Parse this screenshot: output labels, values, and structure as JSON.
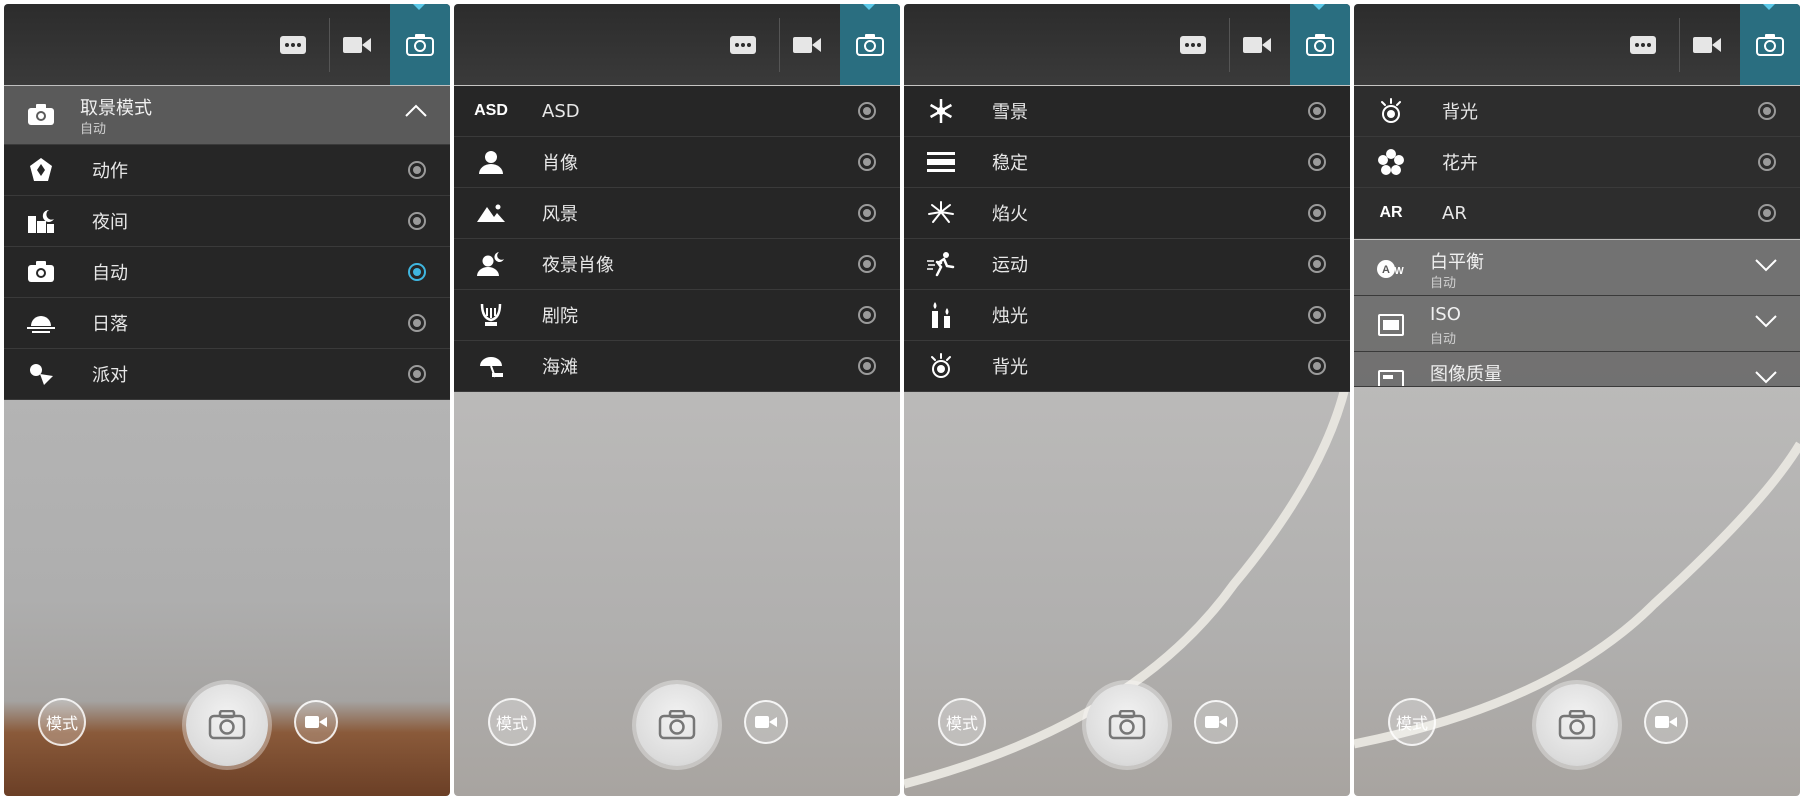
{
  "panels": [
    {
      "header": {
        "title": "取景模式",
        "subtitle": "自动"
      },
      "items": [
        {
          "label": "动作",
          "icon": "action-icon",
          "selected": false
        },
        {
          "label": "夜间",
          "icon": "night-icon",
          "selected": false
        },
        {
          "label": "自动",
          "icon": "camera-icon",
          "selected": true
        },
        {
          "label": "日落",
          "icon": "sunset-icon",
          "selected": false
        },
        {
          "label": "派对",
          "icon": "party-icon",
          "selected": false
        }
      ],
      "mode_label": "模式"
    },
    {
      "items": [
        {
          "label": "ASD",
          "icon_text": "ASD",
          "selected": false
        },
        {
          "label": "肖像",
          "icon": "portrait-icon",
          "selected": false
        },
        {
          "label": "风景",
          "icon": "landscape-icon",
          "selected": false
        },
        {
          "label": "夜景肖像",
          "icon": "night-portrait-icon",
          "selected": false
        },
        {
          "label": "剧院",
          "icon": "theater-icon",
          "selected": false
        },
        {
          "label": "海滩",
          "icon": "beach-icon",
          "selected": false
        }
      ],
      "mode_label": "模式"
    },
    {
      "items": [
        {
          "label": "雪景",
          "icon": "snow-icon",
          "selected": false
        },
        {
          "label": "稳定",
          "icon": "steady-icon",
          "selected": false
        },
        {
          "label": "焰火",
          "icon": "fireworks-icon",
          "selected": false
        },
        {
          "label": "运动",
          "icon": "sports-icon",
          "selected": false
        },
        {
          "label": "烛光",
          "icon": "candlelight-icon",
          "selected": false
        },
        {
          "label": "背光",
          "icon": "backlight-icon",
          "selected": false
        }
      ],
      "mode_label": "模式"
    },
    {
      "items": [
        {
          "label": "背光",
          "icon": "backlight-icon",
          "selected": false
        },
        {
          "label": "花卉",
          "icon": "flower-icon",
          "selected": false
        },
        {
          "label": "AR",
          "icon_text": "AR",
          "selected": false
        }
      ],
      "settings": [
        {
          "title": "白平衡",
          "subtitle": "自动",
          "icon": "white-balance-icon"
        },
        {
          "title": "ISO",
          "subtitle": "自动",
          "icon": "iso-icon"
        },
        {
          "title": "图像质量",
          "subtitle": "",
          "icon": "image-quality-icon"
        }
      ],
      "mode_label": "模式"
    }
  ],
  "colors": {
    "accent": "#3fb6e0",
    "active_tab": "#2a6e80",
    "menu_bg": "#262626"
  }
}
